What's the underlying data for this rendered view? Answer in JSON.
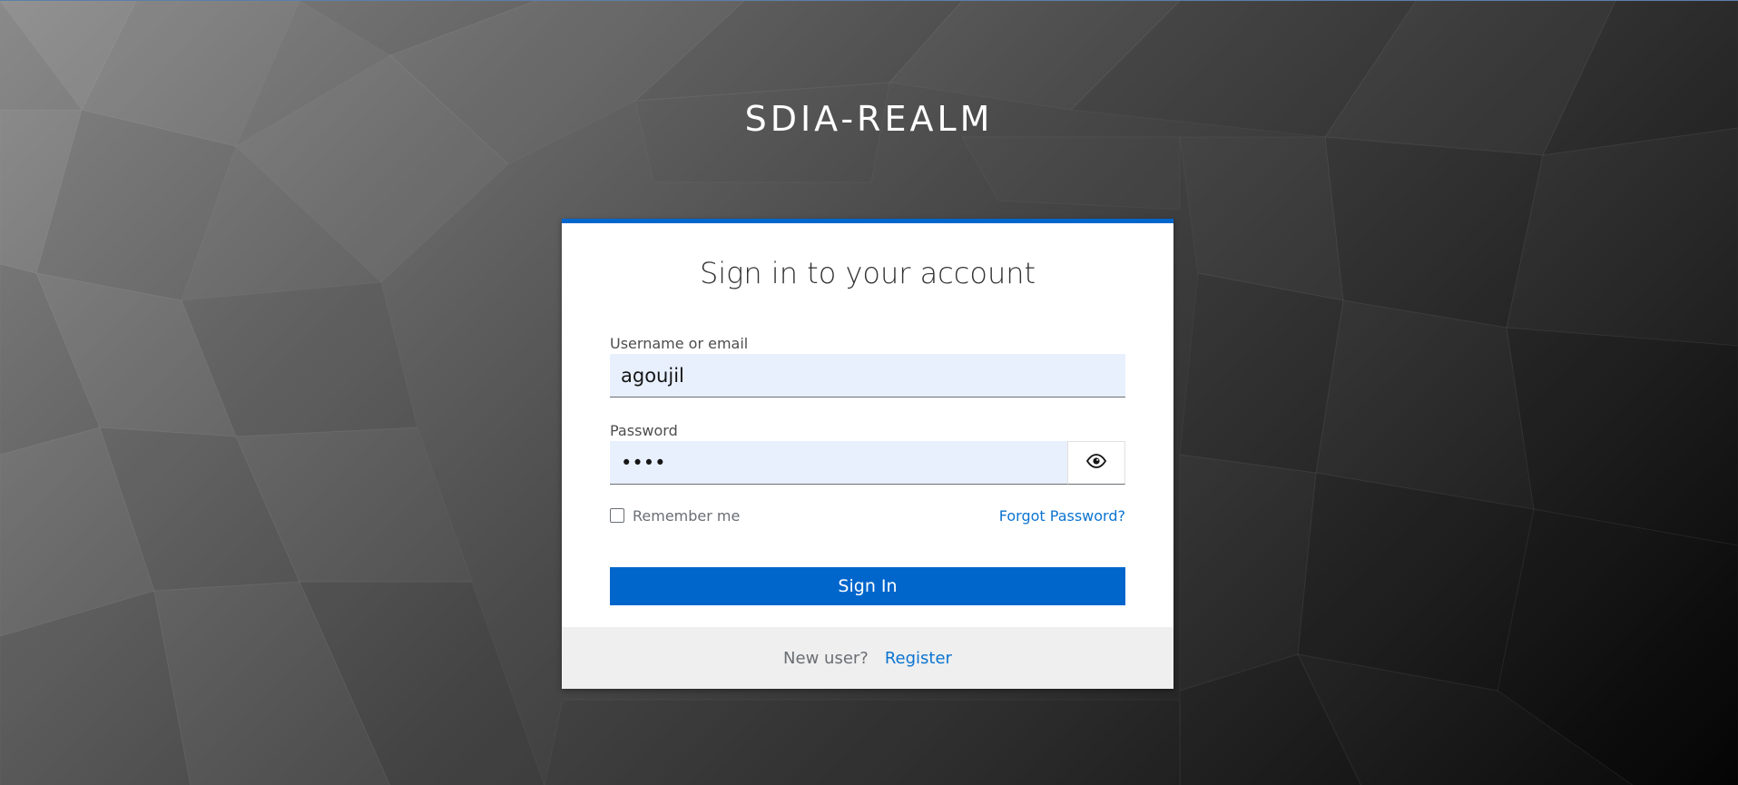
{
  "realm": {
    "title": "SDIA-REALM"
  },
  "login_card": {
    "header": "Sign in to your account",
    "username": {
      "label": "Username or email",
      "value": "agoujil"
    },
    "password": {
      "label": "Password",
      "value": "••••",
      "toggle_icon": "eye-icon"
    },
    "remember_me": {
      "label": "Remember me",
      "checked": false
    },
    "forgot_password": "Forgot Password?",
    "submit_label": "Sign In",
    "footer": {
      "prompt": "New user?",
      "register_label": "Register"
    }
  },
  "colors": {
    "accent": "#0066cc",
    "link": "#0b74d1",
    "input_bg": "#e8f0fe",
    "footer_bg": "#efefef"
  }
}
